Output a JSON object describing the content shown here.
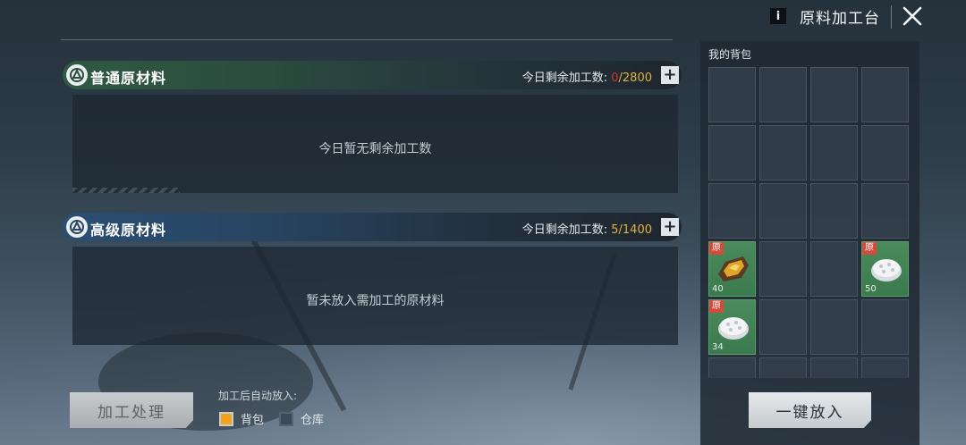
{
  "window": {
    "title": "原料加工台",
    "info_label": "i"
  },
  "sections": [
    {
      "title": "普通原材料",
      "quota_label": "今日剩余加工数:",
      "quota_current": "0",
      "quota_max": "/2800",
      "message": "今日暂无剩余加工数",
      "theme": "green"
    },
    {
      "title": "高级原材料",
      "quota_label": "今日剩余加工数:",
      "quota_current": "5",
      "quota_max": "/1400",
      "message": "暂未放入需加工的原材料",
      "theme": "blue"
    }
  ],
  "controls": {
    "process_label": "加工处理",
    "auto_place_label": "加工后自动放入:",
    "options": [
      {
        "label": "背包",
        "checked": true
      },
      {
        "label": "仓库",
        "checked": false
      }
    ]
  },
  "backpack": {
    "title": "我的背包",
    "items": [
      {
        "slot": 12,
        "tag": "原",
        "count": "40",
        "icon": "wood-ore-icon"
      },
      {
        "slot": 15,
        "tag": "原",
        "count": "50",
        "icon": "silver-ore-icon"
      },
      {
        "slot": 16,
        "tag": "原",
        "count": "34",
        "icon": "silver-ore-icon"
      }
    ],
    "fill_label": "一键放入"
  },
  "colors": {
    "accent_gold": "#e1b240",
    "alert_red": "#d2322d",
    "item_green": "#3b7a4e",
    "tag_red": "#d44a3c"
  }
}
